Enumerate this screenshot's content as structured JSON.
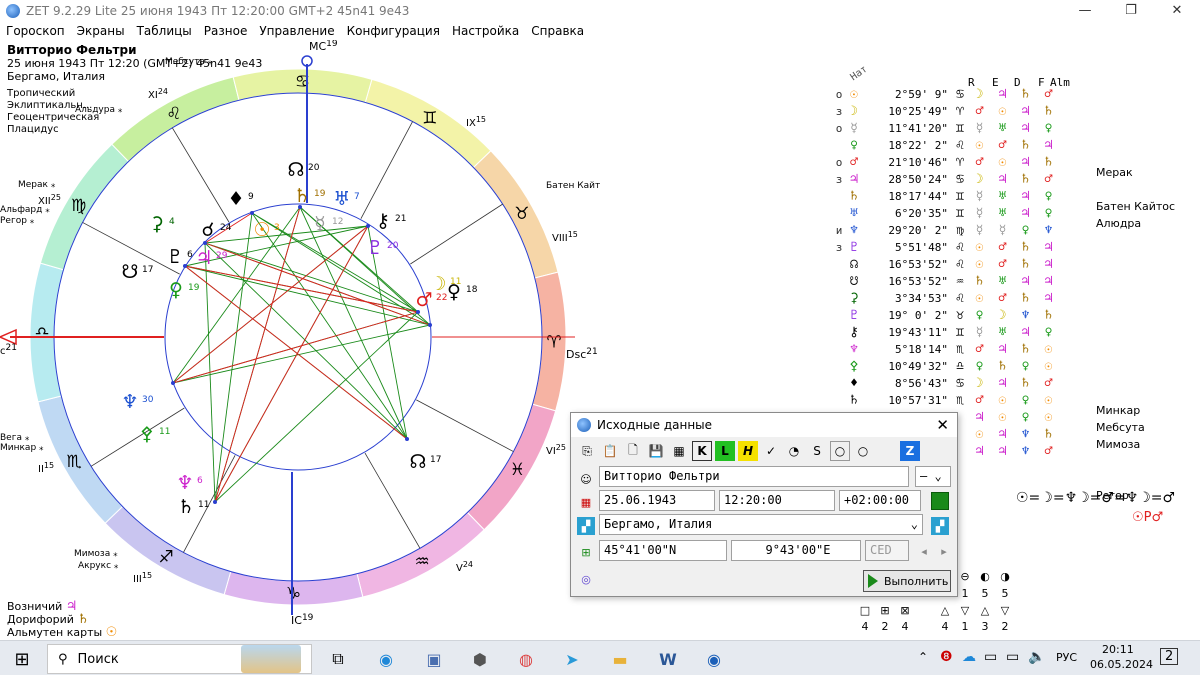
{
  "window": {
    "title": "ZET 9.2.29 Lite   25 июня 1943   Пт   12:20:00 GMT+2 45n41  9e43"
  },
  "menu": [
    "Гороскоп",
    "Экраны",
    "Таблицы",
    "Разное",
    "Управление",
    "Конфигурация",
    "Настройка",
    "Справка"
  ],
  "info": {
    "name": "Витторио Фельтри",
    "line2": "25 июня 1943  Пт  12:20 (GMT+2) 45n41  9e43",
    "place": "Бергамо, Италия",
    "settings": [
      "Тропический",
      "Эклиптикальн...",
      "Геоцентрическая",
      "Плацидус"
    ]
  },
  "chart": {
    "axis_labels": {
      "mc": "MC",
      "mc_deg": "19",
      "ic": "IC",
      "ic_deg": "19",
      "dsc": "Dsc",
      "dsc_deg": "21",
      "asc_deg": "21"
    },
    "houses": [
      {
        "n": "IX",
        "d": "15"
      },
      {
        "n": "VIII",
        "d": "15"
      },
      {
        "n": "VI",
        "d": "25"
      },
      {
        "n": "V",
        "d": "24"
      },
      {
        "n": "III",
        "d": "15"
      },
      {
        "n": "II",
        "d": "15"
      },
      {
        "n": "XII",
        "d": "25"
      },
      {
        "n": "XI",
        "d": "24"
      }
    ],
    "sign_glyphs": [
      "♊",
      "♉",
      "♈",
      "♓",
      "♒",
      "♑",
      "♐",
      "♏",
      "♎",
      "♍",
      "♌",
      "♋"
    ],
    "planets": [
      {
        "g": "☉",
        "d": "3",
        "color": "#f08a00"
      },
      {
        "g": "☽",
        "d": "11",
        "color": "#c8b400"
      },
      {
        "g": "☿",
        "d": "12",
        "color": "#999999"
      },
      {
        "g": "♀",
        "d": "19",
        "color": "#1a9a1a"
      },
      {
        "g": "♂",
        "d": "22",
        "color": "#e02020"
      },
      {
        "g": "♃",
        "d": "29",
        "color": "#cc22cc"
      },
      {
        "g": "♄",
        "d": "19",
        "color": "#a07000"
      },
      {
        "g": "♅",
        "d": "7",
        "color": "#1a4fd0"
      },
      {
        "g": "♆",
        "d": "30",
        "color": "#1a4fd0"
      },
      {
        "g": "♇",
        "d": "20",
        "color": "#8a2be2"
      },
      {
        "g": "☊",
        "d": "17",
        "color": "#000000"
      },
      {
        "g": "☋",
        "d": "17",
        "color": "#000000"
      },
      {
        "g": "♇",
        "d": "6",
        "color": "#000000"
      },
      {
        "g": "⚳",
        "d": "4",
        "color": "#006400"
      },
      {
        "g": "♆",
        "d": "6",
        "color": "#cc22cc"
      },
      {
        "g": "♄",
        "d": "11",
        "color": "#000000"
      },
      {
        "g": "☊",
        "d": "20",
        "color": "#000000"
      },
      {
        "g": "⚴",
        "d": "11",
        "color": "#1a9a1a"
      },
      {
        "g": "♦",
        "d": "9",
        "color": "#000000"
      },
      {
        "g": "☌",
        "d": "24",
        "color": "#000000"
      },
      {
        "g": "♀",
        "d": "18",
        "color": "#000000"
      },
      {
        "g": "⚷",
        "d": "21",
        "color": "#000000"
      }
    ],
    "stars": [
      {
        "name": "Альдура"
      },
      {
        "name": "Мерак"
      },
      {
        "name": "Альфард"
      },
      {
        "name": "Регор"
      },
      {
        "name": "Батен Кайтос"
      },
      {
        "name": "Мимоза"
      },
      {
        "name": "Акрукс"
      },
      {
        "name": "Вега"
      },
      {
        "name": "Минкар"
      },
      {
        "name": "Мебсута"
      }
    ]
  },
  "bottom_left": [
    {
      "label": "Возничий",
      "sym": "♃",
      "color": "#cc22cc"
    },
    {
      "label": "Дорифорий",
      "sym": "♄",
      "color": "#a07000"
    },
    {
      "label": "Альмутен карты",
      "sym": "☉",
      "color": "#f08a00"
    }
  ],
  "table": {
    "headers": {
      "nat": "Нат",
      "r": "R",
      "e": "E",
      "d": "D",
      "f": "F",
      "alm": "Alm"
    },
    "rows": [
      {
        "m": "о",
        "p": "☉",
        "pc": "#f08a00",
        "pos": "2°59' 9\"",
        "s": "♋"
      },
      {
        "m": "з",
        "p": "☽",
        "pc": "#c8b400",
        "pos": "10°25'49\"",
        "s": "♈"
      },
      {
        "m": "о",
        "p": "☿",
        "pc": "#999999",
        "pos": "11°41'20\"",
        "s": "♊"
      },
      {
        "m": "",
        "p": "♀",
        "pc": "#1a9a1a",
        "pos": "18°22' 2\"",
        "s": "♌"
      },
      {
        "m": "о",
        "p": "♂",
        "pc": "#e02020",
        "pos": "21°10'46\"",
        "s": "♈"
      },
      {
        "m": "з",
        "p": "♃",
        "pc": "#cc22cc",
        "pos": "28°50'24\"",
        "s": "♋"
      },
      {
        "m": "",
        "p": "♄",
        "pc": "#a07000",
        "pos": "18°17'44\"",
        "s": "♊"
      },
      {
        "m": "",
        "p": "♅",
        "pc": "#1a4fd0",
        "pos": "6°20'35\"",
        "s": "♊"
      },
      {
        "m": "и",
        "p": "♆",
        "pc": "#1a4fd0",
        "pos": "29°20' 2\"",
        "s": "♍"
      },
      {
        "m": "з",
        "p": "♇",
        "pc": "#8a2be2",
        "pos": "5°51'48\"",
        "s": "♌"
      },
      {
        "m": "",
        "p": "☊",
        "pc": "#000000",
        "pos": "16°53'52\"",
        "s": "♌"
      },
      {
        "m": "",
        "p": "☋",
        "pc": "#000000",
        "pos": "16°53'52\"",
        "s": "♒"
      },
      {
        "m": "",
        "p": "⚳",
        "pc": "#006400",
        "pos": "3°34'53\"",
        "s": "♌"
      },
      {
        "m": "",
        "p": "♇",
        "pc": "#8a2be2",
        "pos": "19° 0' 2\"",
        "s": "♉"
      },
      {
        "m": "",
        "p": "⚷",
        "pc": "#000000",
        "pos": "19°43'11\"",
        "s": "♊"
      },
      {
        "m": "",
        "p": "♆",
        "pc": "#cc22cc",
        "pos": "5°18'14\"",
        "s": "♏"
      },
      {
        "m": "",
        "p": "⚴",
        "pc": "#1a9a1a",
        "pos": "10°49'32\"",
        "s": "♎"
      },
      {
        "m": "",
        "p": "♦",
        "pc": "#000000",
        "pos": "8°56'43\"",
        "s": "♋"
      },
      {
        "m": "",
        "p": "♄",
        "pc": "#000000",
        "pos": "10°57'31\"",
        "s": "♏"
      },
      {
        "m": "",
        "p": "☊",
        "pc": "#000000",
        "pos": "",
        "s": ""
      },
      {
        "m": "",
        "p": "☉",
        "pc": "#000000",
        "pos": "",
        "s": ""
      },
      {
        "m": "",
        "p": "☿",
        "pc": "#000000",
        "pos": "",
        "s": ""
      }
    ],
    "rulers": [
      [
        "☽",
        "♃",
        "♄",
        "♂"
      ],
      [
        "♂",
        "☉",
        "♃",
        "♄"
      ],
      [
        "☿",
        "♅",
        "♃",
        "♀"
      ],
      [
        "☉",
        "♂",
        "♄",
        "♃"
      ],
      [
        "♂",
        "☉",
        "♃",
        "♄"
      ],
      [
        "☽",
        "♃",
        "♄",
        "♂"
      ],
      [
        "☿",
        "♅",
        "♃",
        "♀"
      ],
      [
        "☿",
        "♅",
        "♃",
        "♀"
      ],
      [
        "☿",
        "☿",
        "♀",
        "♆"
      ],
      [
        "☉",
        "♂",
        "♄",
        "♃"
      ],
      [
        "☉",
        "♂",
        "♄",
        "♃"
      ],
      [
        "♄",
        "♅",
        "♃",
        "♃"
      ],
      [
        "☉",
        "♂",
        "♄",
        "♃"
      ],
      [
        "♀",
        "☽",
        "♆",
        "♄"
      ],
      [
        "☿",
        "♅",
        "♃",
        "♀"
      ],
      [
        "♂",
        "♃",
        "♄",
        "☉"
      ],
      [
        "♀",
        "♄",
        "♀",
        "☉"
      ],
      [
        "☽",
        "♃",
        "♄",
        "♂"
      ],
      [
        "♂",
        "☉",
        "♀",
        "☉"
      ],
      [
        "♃",
        "☉",
        "♀",
        "☉"
      ],
      [
        "☉",
        "♃",
        "♆",
        "♄"
      ],
      [
        "♃",
        "♃",
        "♆",
        "♂"
      ]
    ],
    "notes": [
      {
        "row": 2,
        "text": "Мерак"
      },
      {
        "row": 4,
        "text": "Батен Кайтос"
      },
      {
        "row": 5,
        "text": "Алюдра"
      },
      {
        "row": 16,
        "text": "Минкар"
      },
      {
        "row": 17,
        "text": "Мебсута"
      },
      {
        "row": 18,
        "text": "Мимоза"
      },
      {
        "row": 21,
        "text": "Регор"
      }
    ],
    "formula": "☉=☽=♆☽=♂=♆☽=♂",
    "formula2": "☉P♂"
  },
  "aspect_grid": {
    "row1_top": [
      "⊖",
      "◐",
      "◑"
    ],
    "row1_bot": [
      "1",
      "5",
      "5"
    ],
    "row2_top": [
      "□",
      "⊞",
      "⊠"
    ],
    "row2_bot": [
      "4",
      "2",
      "4"
    ],
    "row3_top": [
      "△",
      "▽",
      "△",
      "▽"
    ],
    "row3_bot": [
      "4",
      "1",
      "3",
      "2"
    ]
  },
  "dialog": {
    "title": "Исходные данные",
    "toolbar": [
      "⎘",
      "📋",
      "🗋",
      "💾",
      "▦",
      "K",
      "L",
      "H",
      "✓",
      "◔",
      "S",
      "○",
      "○",
      "Z"
    ],
    "name": "Витторио Фельтри",
    "name_opt": "—",
    "date": "25.06.1943",
    "time": "12:20:00",
    "tz": "+02:00:00",
    "place": "Бергамо, Италия",
    "lat": "45°41'00\"N",
    "lon": "9°43'00\"E",
    "tz_name": "CED",
    "ok": "Выполнить"
  },
  "taskbar": {
    "search": "Поиск",
    "lang": "РУС",
    "time": "20:11",
    "date": "06.05.2024",
    "notif": "2"
  }
}
